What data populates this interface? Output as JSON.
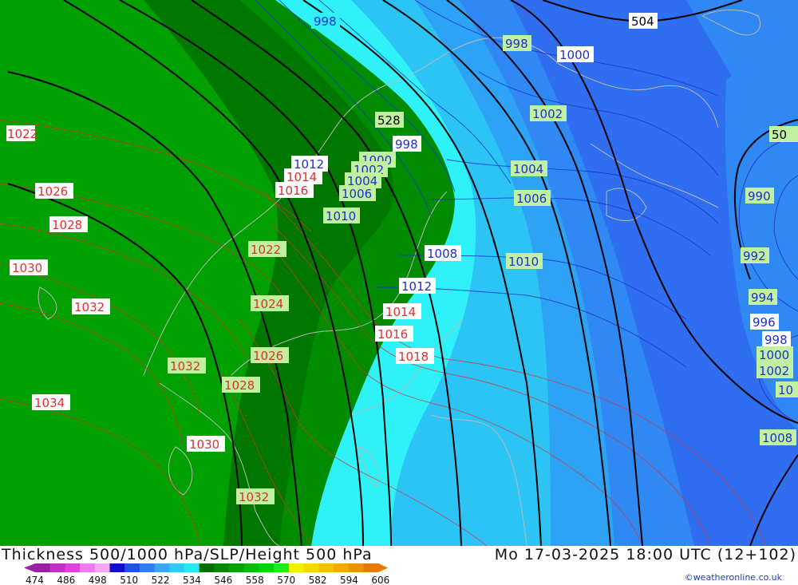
{
  "title": "Thickness 500/1000 hPa/SLP/Height 500 hPa",
  "datetime": "Mo 17-03-2025 18:00 UTC (12+102)",
  "credit": "©weatheronline.co.uk",
  "scale": {
    "labels": [
      "474",
      "486",
      "498",
      "510",
      "522",
      "534",
      "546",
      "558",
      "570",
      "582",
      "594",
      "606"
    ],
    "colors": [
      "#9a1fa8",
      "#c92ec9",
      "#e040e0",
      "#f07af0",
      "#f5a6f5",
      "#1010c8",
      "#2050e8",
      "#2f7ff5",
      "#35a8f7",
      "#30c8f5",
      "#29e8f5",
      "#006e00",
      "#008a00",
      "#00a200",
      "#00bc00",
      "#00d400",
      "#19ec19",
      "#f0f000",
      "#f5d800",
      "#f5c000",
      "#f5a800",
      "#f09000",
      "#e87800"
    ]
  },
  "colors": {
    "green_dark": "#007800",
    "green_mid": "#008c00",
    "cyan": "#2ef2f7",
    "light_blue": "#2bc4f5",
    "sky_blue": "#2ea3f5",
    "blue": "#2f88f3",
    "deep_blue": "#2f6ef0",
    "slp_low": "#1f2fd0",
    "slp_high": "#e03030",
    "height": "#000000",
    "coast": "#b8b8b8"
  },
  "map": {
    "height_labels": [
      "504",
      "528",
      "50"
    ],
    "slp_labels_blue": [
      "998",
      "998",
      "1000",
      "998",
      "1002",
      "990",
      "992",
      "994",
      "996",
      "998",
      "1000",
      "1002",
      "10",
      "1008",
      "1012",
      "1008",
      "1012",
      "1000",
      "1002",
      "1004",
      "1006",
      "1004",
      "1006",
      "1010",
      "1010"
    ],
    "slp_labels_red": [
      "1022",
      "1026",
      "1028",
      "1030",
      "1032",
      "1034",
      "1014",
      "1016",
      "1022",
      "1024",
      "1026",
      "1028",
      "1032",
      "1030",
      "1032",
      "1014",
      "1016",
      "1018"
    ]
  }
}
